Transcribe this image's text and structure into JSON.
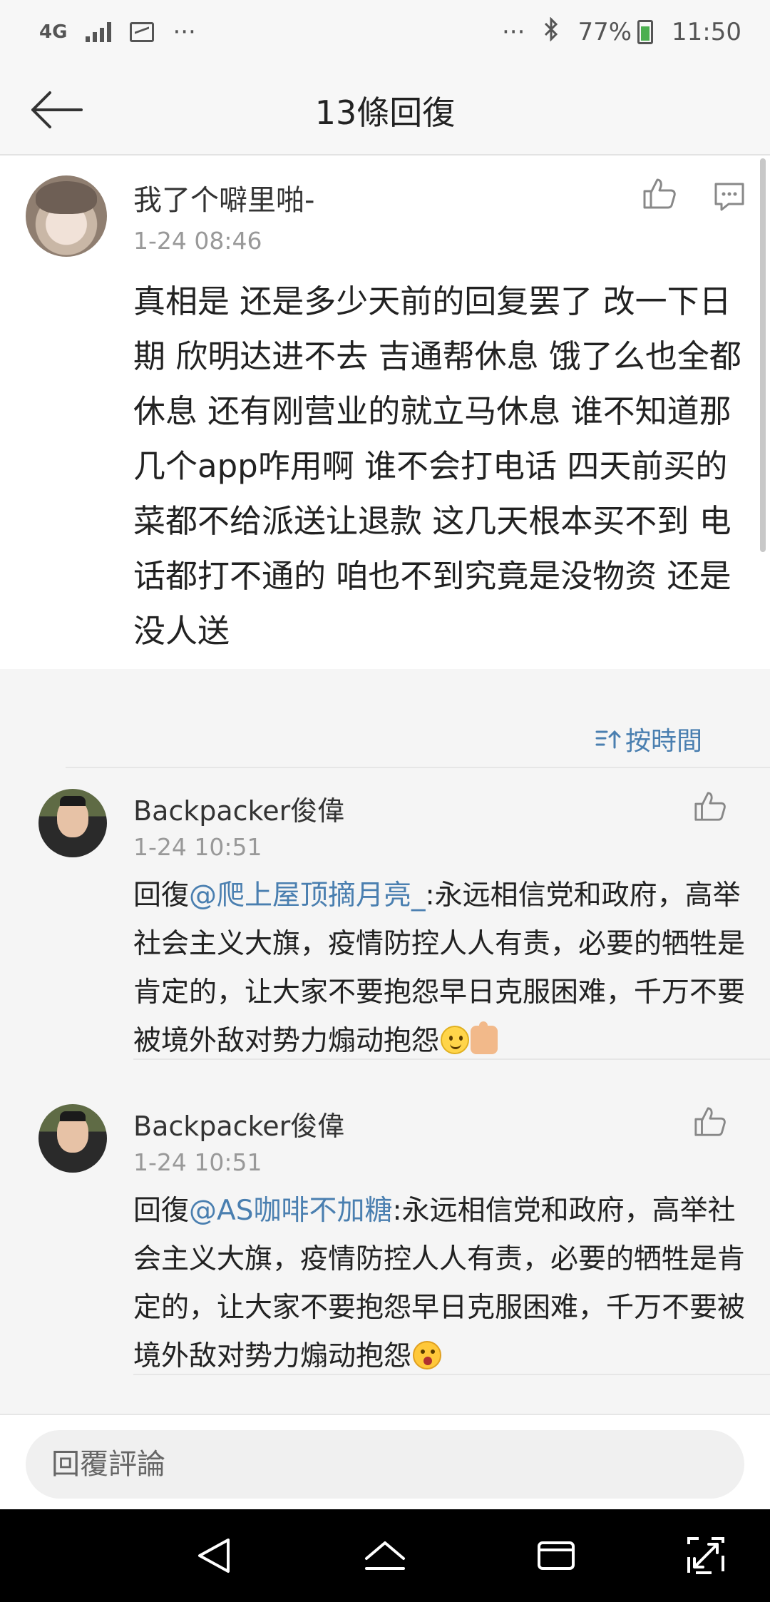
{
  "status_bar": {
    "network": "4G",
    "more": "···",
    "more_right": "···",
    "battery": "77%",
    "time": "11:50",
    "icons": [
      "network-4g-icon",
      "signal-icon",
      "image-icon",
      "bluetooth-icon",
      "battery-icon"
    ]
  },
  "header": {
    "title": "13條回復",
    "back_icon": "arrow-left-icon"
  },
  "main_post": {
    "author": "我了个噼里啪-",
    "time": "1-24 08:46",
    "content": "真相是 还是多少天前的回复罢了 改一下日期 欣明达进不去 吉通帮休息 饿了么也全都休息 还有刚营业的就立马休息 谁不知道那几个app咋用啊 谁不会打电话 四天前买的菜都不给派送让退款 这几天根本买不到 电话都打不通的 咱也不到究竟是没物资 还是没人送"
  },
  "sort": {
    "label": "按時間",
    "icon": "sort-time-icon"
  },
  "replies": [
    {
      "author": "Backpacker俊偉",
      "time": "1-24 10:51",
      "prefix": "回復",
      "mention": "@爬上屋顶摘月亮_",
      "text": ":永远相信党和政府，高举社会主义大旗，疫情防控人人有责，必要的牺牲是肯定的，让大家不要抱怨早日克服困难，千万不要被境外敌对势力煽动抱怨",
      "emojis": [
        "slightly-smiling-emoji",
        "thumbs-up-emoji"
      ]
    },
    {
      "author": "Backpacker俊偉",
      "time": "1-24 10:51",
      "prefix": "回復",
      "mention": "@AS咖啡不加糖",
      "text": ":永远相信党和政府，高举社会主义大旗，疫情防控人人有责，必要的牺牲是肯定的，让大家不要抱怨早日克服困难，千万不要被境外敌对势力煽动抱怨",
      "emojis": [
        "shocked-emoji"
      ]
    }
  ],
  "comment_bar": {
    "placeholder": "回覆評論"
  },
  "colors": {
    "link": "#4a7fb0",
    "background": "#f5f5f5",
    "card": "#ffffff",
    "meta_text": "#999999"
  }
}
